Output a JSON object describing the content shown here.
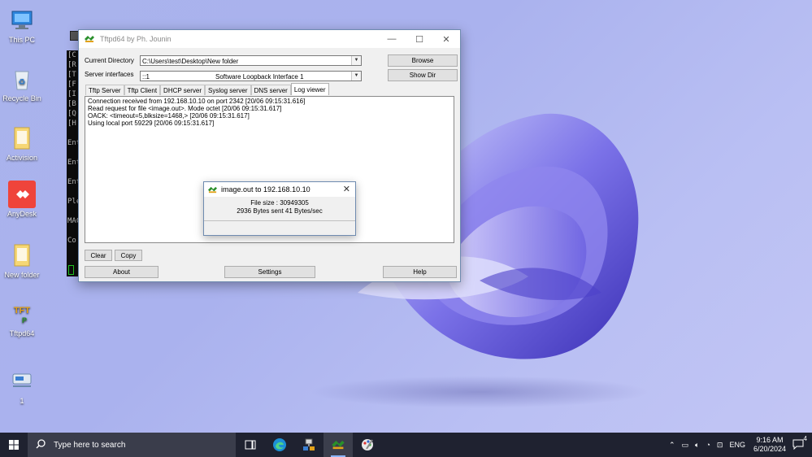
{
  "desktop": {
    "icons": [
      {
        "label": "This PC"
      },
      {
        "label": "Recycle Bin"
      },
      {
        "label": "Activision"
      },
      {
        "label": "AnyDesk"
      },
      {
        "label": "New folder"
      },
      {
        "label": "Tftpd64"
      },
      {
        "label": "1"
      }
    ]
  },
  "console": {
    "lines": [
      "[C",
      "[R",
      "[T",
      "[F",
      "[I",
      "[B",
      "[Q",
      "[H",
      "",
      "Ent",
      "",
      "Ent",
      "",
      "Ent",
      "",
      "Ple",
      "",
      "MAC",
      "",
      "Co"
    ]
  },
  "window": {
    "title": "Tftpd64 by Ph. Jounin",
    "current_directory_label": "Current Directory",
    "current_directory_value": "C:\\Users\\test\\Desktop\\New folder",
    "server_interfaces_label": "Server interfaces",
    "server_interface_ip": "::1",
    "server_interface_name": "Software Loopback Interface 1",
    "browse_label": "Browse",
    "showdir_label": "Show Dir",
    "tabs": [
      "Tftp Server",
      "Tftp Client",
      "DHCP server",
      "Syslog server",
      "DNS server",
      "Log viewer"
    ],
    "active_tab": "Log viewer",
    "log_lines": [
      "Connection received from 192.168.10.10 on port 2342 [20/06 09:15:31.616]",
      "Read request for file <image.out>. Mode octet [20/06 09:15:31.617]",
      "OACK: <timeout=5,blksize=1468,> [20/06 09:15:31.617]",
      "Using local port 59229 [20/06 09:15:31.617]"
    ],
    "clear_label": "Clear",
    "copy_label": "Copy",
    "about_label": "About",
    "settings_label": "Settings",
    "help_label": "Help"
  },
  "popup": {
    "title": "image.out to 192.168.10.10",
    "file_size": "File size : 30949305",
    "progress_text": "2936 Bytes sent  41 Bytes/sec"
  },
  "taskbar": {
    "search_placeholder": "Type here to search",
    "language": "ENG",
    "time": "9:16 AM",
    "date": "6/20/2024",
    "notification_count": "4"
  },
  "colors": {
    "accent": "#8ab4f8",
    "taskbar": "#1f2230",
    "window_border": "#6f8bb0"
  }
}
